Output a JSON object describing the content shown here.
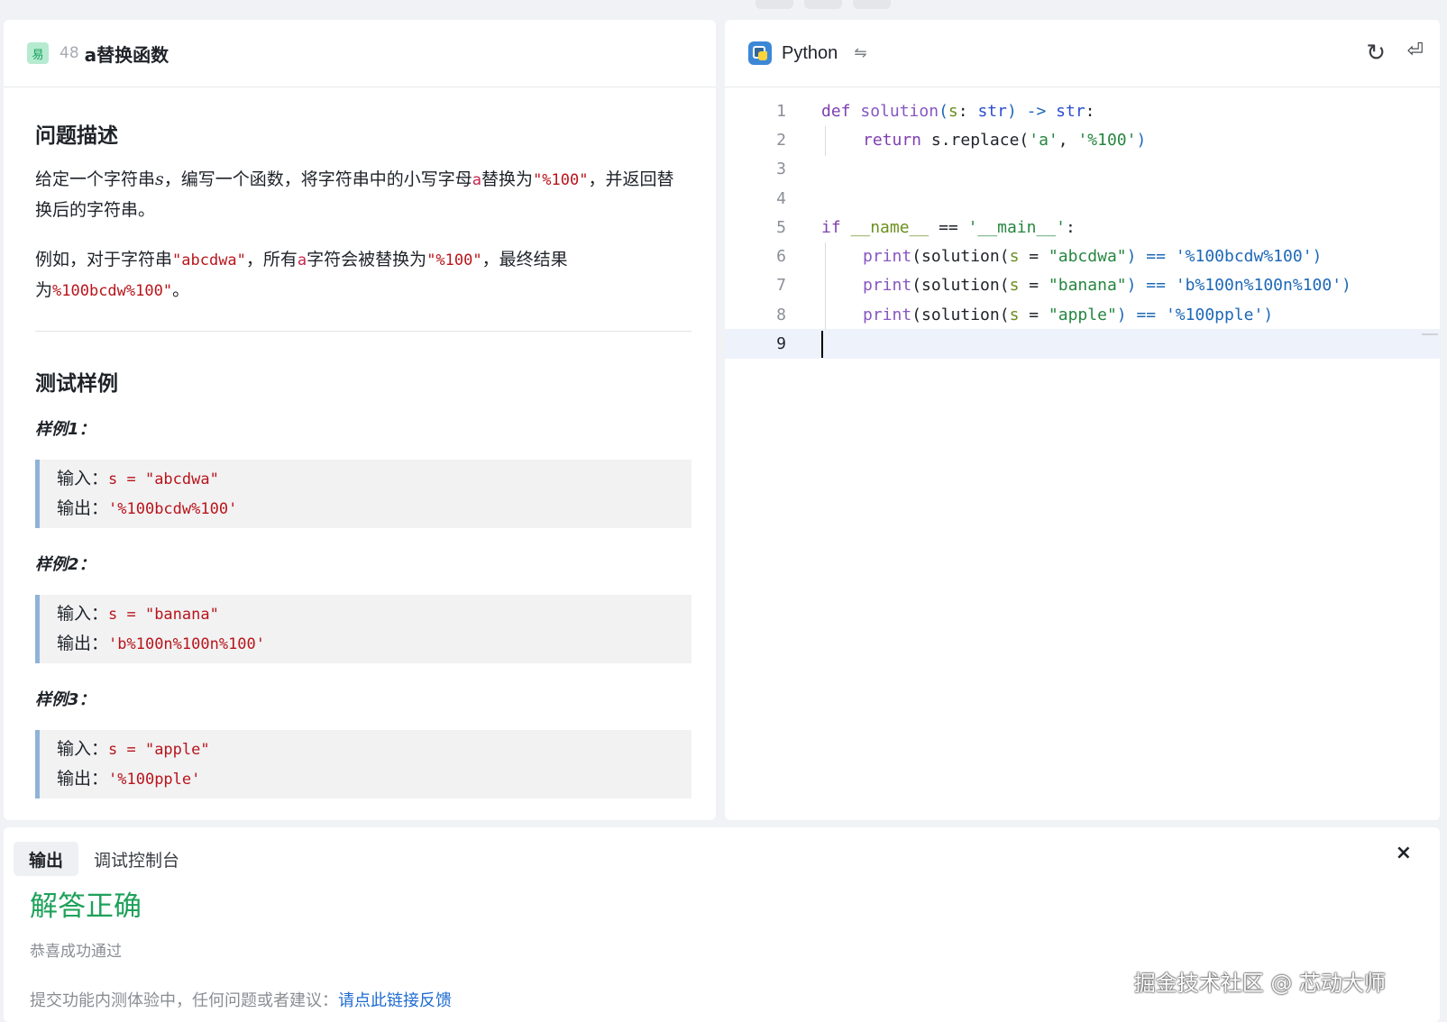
{
  "problem": {
    "difficulty": "易",
    "number": "48",
    "title": "a替换函数",
    "description_title": "问题描述",
    "desc_p1_a": "给定一个字符串",
    "desc_p1_var": "s",
    "desc_p1_b": "，编写一个函数，将字符串中的小写字母",
    "desc_p1_letter": "a",
    "desc_p1_c": "替换为",
    "desc_p1_code": "\"%100\"",
    "desc_p1_d": "，并返回替换后的字符串。",
    "desc_p2_a": "例如，对于字符串",
    "desc_p2_code": "\"abcdwa\"",
    "desc_p2_b": "，所有",
    "desc_p2_letter": "a",
    "desc_p2_c": "字符会被替换为",
    "desc_p2_code2": "\"%100\"",
    "desc_p2_d": "，最终结果为",
    "desc_p2_code3": "%100bcdw%100\"",
    "desc_p2_e": "。",
    "tests_title": "测试样例",
    "examples": [
      {
        "label": "样例1：",
        "in_label": "输入：",
        "in_code": "s = \"abcdwa\"",
        "out_label": "输出：",
        "out_code": "'%100bcdw%100'"
      },
      {
        "label": "样例2：",
        "in_label": "输入：",
        "in_code": "s = \"banana\"",
        "out_label": "输出：",
        "out_code": "'b%100n%100n%100'"
      },
      {
        "label": "样例3：",
        "in_label": "输入：",
        "in_code": "s = \"apple\"",
        "out_label": "输出：",
        "out_code": "'%100pple'"
      }
    ]
  },
  "editor": {
    "language": "Python",
    "icons": {
      "language": "python-icon",
      "swap": "swap-icon",
      "refresh": "refresh-icon",
      "wrap": "wrap-icon"
    },
    "line_numbers": [
      "1",
      "2",
      "3",
      "4",
      "5",
      "6",
      "7",
      "8",
      "9"
    ],
    "l1": {
      "def": "def",
      "fn": "solution",
      "p1": "(",
      "arg": "s",
      "p2": ": ",
      "type": "str",
      "p3": ") -> ",
      "ret": "str",
      "p4": ":"
    },
    "l2": {
      "kw": "return",
      "rest": " s.replace(",
      "s1": "'a'",
      "comma": ", ",
      "s2": "'%100'",
      "end": ")"
    },
    "l5": {
      "kw": "if",
      "name": "__name__",
      "eq": " == ",
      "main": "'__main__'",
      "end": ":"
    },
    "calls": [
      {
        "print": "print",
        "a": "(solution(",
        "s": "s",
        "eq": " = ",
        "str": "\"abcdwa\"",
        "b": ") == ",
        "exp": "'%100bcdw%100'",
        "c": ")"
      },
      {
        "print": "print",
        "a": "(solution(",
        "s": "s",
        "eq": " = ",
        "str": "\"banana\"",
        "b": ") == ",
        "exp": "'b%100n%100n%100'",
        "c": ")"
      },
      {
        "print": "print",
        "a": "(solution(",
        "s": "s",
        "eq": " = ",
        "str": "\"apple\"",
        "b": ") == ",
        "exp": "'%100pple'",
        "c": ")"
      }
    ]
  },
  "output": {
    "tabs": [
      "输出",
      "调试控制台"
    ],
    "close": "×",
    "result": "解答正确",
    "result_sub": "恭喜成功通过",
    "feedback_text": "提交功能内测体验中，任何问题或者建议：",
    "feedback_link": "请点此链接反馈",
    "watermark": "掘金技术社区 @ 芯动大师"
  },
  "colors": {
    "success": "#1ea15a",
    "link": "#1e6bd1",
    "code_red": "#b8151b"
  }
}
